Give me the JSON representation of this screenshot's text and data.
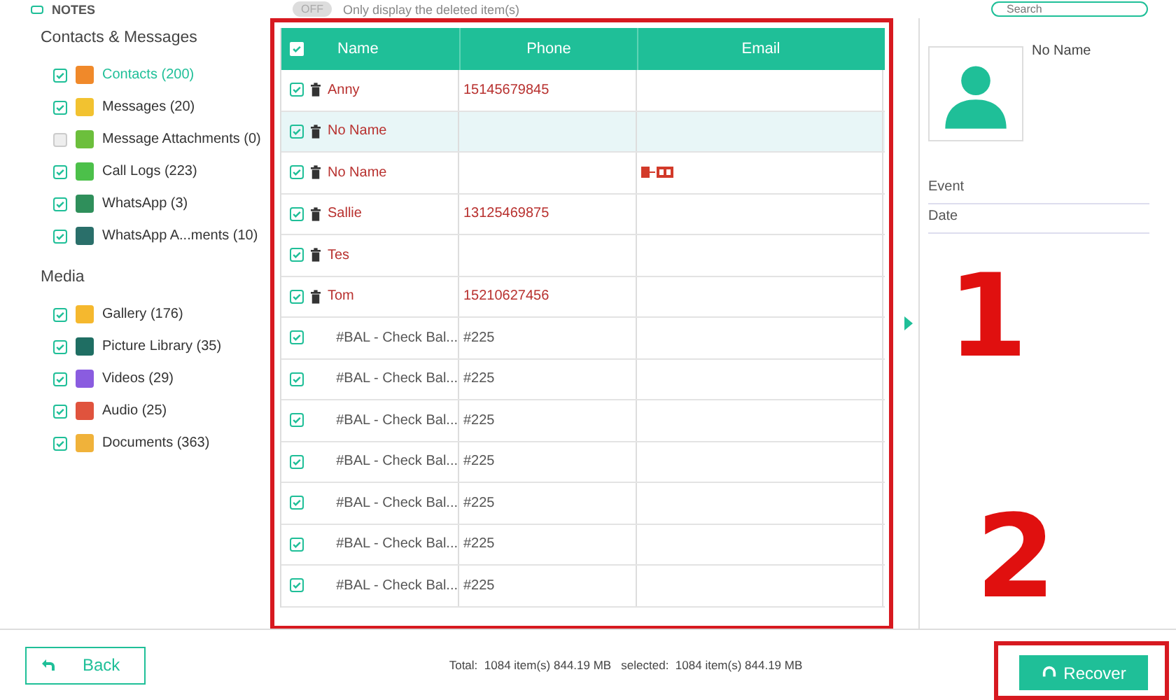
{
  "top": {
    "notes_checked": true,
    "notes_label": "NOTES",
    "toggle": {
      "label": "OFF",
      "on": false
    },
    "filter_label": "Only display the deleted item(s)",
    "search": {
      "placeholder": "Search"
    }
  },
  "sidebar": {
    "sections": [
      {
        "title": "Contacts & Messages",
        "items": [
          {
            "label": "Contacts (200)",
            "checked": true,
            "selected": true,
            "color": "#f0892a"
          },
          {
            "label": "Messages (20)",
            "checked": true,
            "selected": false,
            "color": "#f2c230"
          },
          {
            "label": "Message Attachments (0)",
            "checked": false,
            "selected": false,
            "color": "#6cbf3c"
          },
          {
            "label": "Call Logs (223)",
            "checked": true,
            "selected": false,
            "color": "#4cc04a"
          },
          {
            "label": "WhatsApp (3)",
            "checked": true,
            "selected": false,
            "color": "#2f8f5b"
          },
          {
            "label": "WhatsApp A...ments (10)",
            "checked": true,
            "selected": false,
            "color": "#2a6f6a"
          }
        ]
      },
      {
        "title": "Media",
        "items": [
          {
            "label": "Gallery (176)",
            "checked": true,
            "selected": false,
            "color": "#f5b82e"
          },
          {
            "label": "Picture Library (35)",
            "checked": true,
            "selected": false,
            "color": "#1f6e63"
          },
          {
            "label": "Videos (29)",
            "checked": true,
            "selected": false,
            "color": "#8a5ce0"
          },
          {
            "label": "Audio (25)",
            "checked": true,
            "selected": false,
            "color": "#e0533d"
          },
          {
            "label": "Documents (363)",
            "checked": true,
            "selected": false,
            "color": "#f0b23a"
          }
        ]
      }
    ]
  },
  "table": {
    "header_checked": true,
    "columns": [
      "Name",
      "Phone",
      "Email"
    ],
    "rows": [
      {
        "name": "Anny",
        "phone": "15145679845",
        "deleted": true,
        "checked": true,
        "selected": false,
        "email_icon": false
      },
      {
        "name": "No Name",
        "deleted": true,
        "checked": true,
        "selected": true,
        "email_icon": false
      },
      {
        "name": "No Name",
        "deleted": true,
        "checked": true,
        "selected": false,
        "email_icon": true
      },
      {
        "name": "Sallie",
        "phone": "13125469875",
        "deleted": true,
        "checked": true,
        "selected": false,
        "email_icon": false
      },
      {
        "name": "Tes",
        "deleted": true,
        "checked": true,
        "selected": false,
        "email_icon": false
      },
      {
        "name": "Tom",
        "phone": "15210627456",
        "deleted": true,
        "checked": true,
        "selected": false,
        "email_icon": false
      },
      {
        "name": "#BAL - Check Bal...",
        "phone": "#225",
        "deleted": false,
        "checked": true,
        "selected": false,
        "email_icon": false
      },
      {
        "name": "#BAL - Check Bal...",
        "phone": "#225",
        "deleted": false,
        "checked": true,
        "selected": false,
        "email_icon": false
      },
      {
        "name": "#BAL - Check Bal...",
        "phone": "#225",
        "deleted": false,
        "checked": true,
        "selected": false,
        "email_icon": false
      },
      {
        "name": "#BAL - Check Bal...",
        "phone": "#225",
        "deleted": false,
        "checked": true,
        "selected": false,
        "email_icon": false
      },
      {
        "name": "#BAL - Check Bal...",
        "phone": "#225",
        "deleted": false,
        "checked": true,
        "selected": false,
        "email_icon": false
      },
      {
        "name": "#BAL - Check Bal...",
        "phone": "#225",
        "deleted": false,
        "checked": true,
        "selected": false,
        "email_icon": false
      },
      {
        "name": "#BAL - Check Bal...",
        "phone": "#225",
        "deleted": false,
        "checked": true,
        "selected": false,
        "email_icon": false
      }
    ]
  },
  "details": {
    "name": "No Name",
    "fields": [
      "Event",
      "Date"
    ]
  },
  "footer": {
    "back": "Back",
    "summary": "Total:  1084 item(s) 844.19 MB   selected:  1084 item(s) 844.19 MB",
    "recover": "Recover"
  },
  "annotations": [
    "1",
    "2"
  ]
}
